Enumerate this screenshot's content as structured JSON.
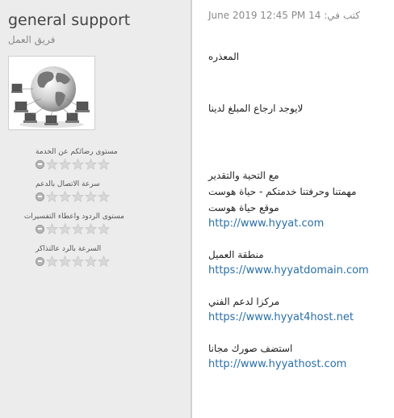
{
  "staff": {
    "name": "general support",
    "role": "فريق العمل"
  },
  "ratings": [
    {
      "label": "مستوى رضائكم عن الخدمة",
      "stars": 0
    },
    {
      "label": "سرعة الاتصال بالدعم",
      "stars": 0
    },
    {
      "label": "مستوى الردود واعطاء التفسيرات",
      "stars": 0
    },
    {
      "label": "السرعة بالرد عالتذاكر",
      "stars": 0
    }
  ],
  "message": {
    "header": "كتب في: 14 June 2019 12:45 PM",
    "apology": "المعذره",
    "refund": "لايوجد ارجاع المبلغ لدينا",
    "greeting": "مع التحية والتقدير",
    "mission": "مهمتنا وحرفتنا خدمتكم - حياة هوست",
    "site_label": "موقع حياة هوست",
    "site_url": "http://www.hyyat.com",
    "client_label": "منطقة العميل",
    "client_url": "https://www.hyyatdomain.com",
    "support_label": "مركزا لدعم الفني",
    "support_url": "https://www.hyyat4host.net",
    "images_label": "استضف صورك مجانا",
    "images_url": "http://www.hyyathost.com"
  },
  "colors": {
    "sidebar_bg": "#ececec",
    "link": "#2a6fa8",
    "star": "#d8d8d8"
  }
}
